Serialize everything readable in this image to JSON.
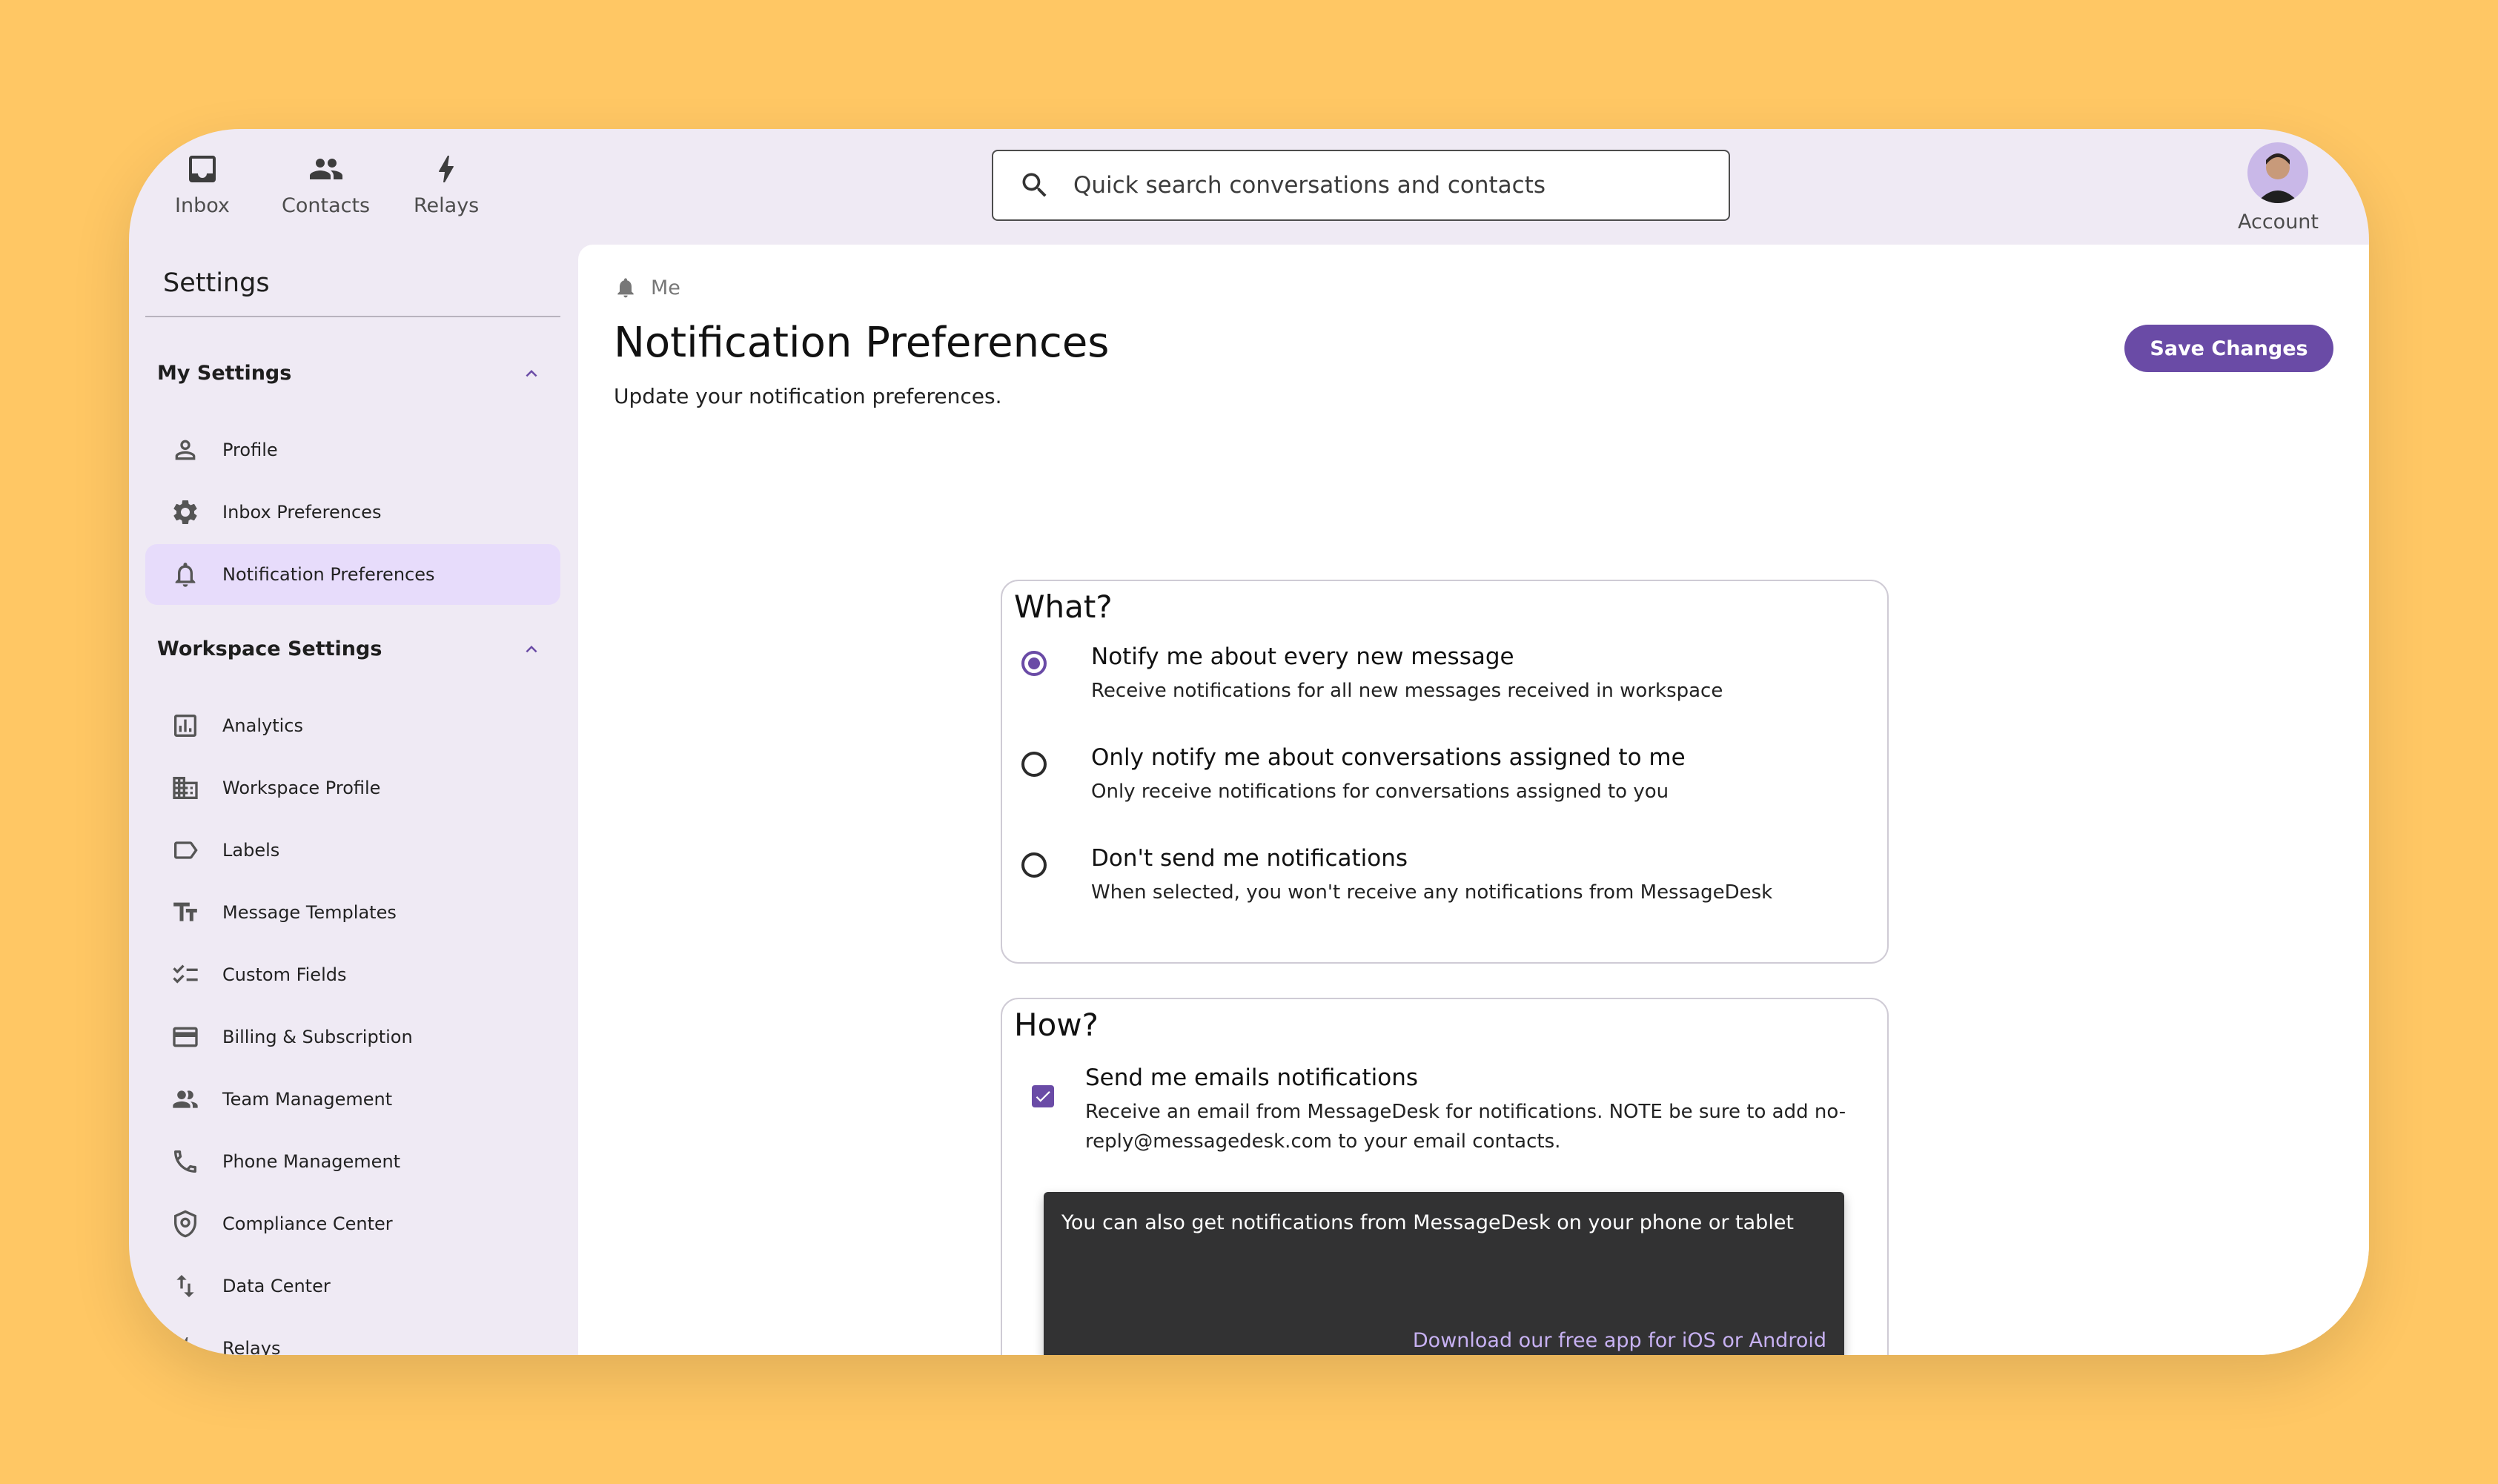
{
  "topnav": {
    "items": [
      {
        "label": "Inbox",
        "icon": "inbox-icon"
      },
      {
        "label": "Contacts",
        "icon": "contacts-icon"
      },
      {
        "label": "Relays",
        "icon": "bolt-icon"
      }
    ],
    "search_placeholder": "Quick search conversations and contacts",
    "account_label": "Account"
  },
  "sidebar": {
    "title": "Settings",
    "my_settings": {
      "label": "My Settings",
      "items": [
        {
          "label": "Profile",
          "icon": "person-icon"
        },
        {
          "label": "Inbox Preferences",
          "icon": "gear-icon"
        },
        {
          "label": "Notification Preferences",
          "icon": "bell-icon",
          "active": true
        }
      ]
    },
    "workspace_settings": {
      "label": "Workspace Settings",
      "items": [
        {
          "label": "Analytics",
          "icon": "analytics-icon"
        },
        {
          "label": "Workspace Profile",
          "icon": "building-icon"
        },
        {
          "label": "Labels",
          "icon": "label-icon"
        },
        {
          "label": "Message Templates",
          "icon": "text-format-icon"
        },
        {
          "label": "Custom Fields",
          "icon": "checklist-icon"
        },
        {
          "label": "Billing & Subscription",
          "icon": "credit-card-icon"
        },
        {
          "label": "Team Management",
          "icon": "team-icon"
        },
        {
          "label": "Phone Management",
          "icon": "phone-icon"
        },
        {
          "label": "Compliance Center",
          "icon": "shield-icon"
        },
        {
          "label": "Data Center",
          "icon": "swap-vertical-icon"
        },
        {
          "label": "Relays",
          "icon": "bolt-icon"
        }
      ]
    }
  },
  "main": {
    "breadcrumb": "Me",
    "title": "Notification Preferences",
    "subtitle": "Update your notification preferences.",
    "save_label": "Save Changes",
    "what": {
      "title": "What?",
      "options": [
        {
          "title": "Notify me about every new message",
          "desc": "Receive notifications for all new messages received in workspace",
          "selected": true
        },
        {
          "title": "Only notify me about conversations assigned to me",
          "desc": "Only receive notifications for conversations assigned to you",
          "selected": false
        },
        {
          "title": "Don't send me notifications",
          "desc": "When selected, you won't receive any notifications from MessageDesk",
          "selected": false
        }
      ]
    },
    "how": {
      "title": "How?",
      "email_title": "Send me emails notifications",
      "email_desc_1": "Receive an email from MessageDesk for notifications. NOTE be sure to add no-",
      "email_desc_2": "reply@messagedesk.com to your email contacts.",
      "email_checked": true,
      "promo_text": "You can also get notifications from MessageDesk on your phone or tablet",
      "promo_link": "Download our free app for iOS or Android"
    }
  },
  "colors": {
    "background": "#FFC764",
    "accent": "#6A4BA6",
    "active_item": "#E7DCFB",
    "promo_bg": "#323233",
    "promo_link": "#C7B1F2"
  }
}
